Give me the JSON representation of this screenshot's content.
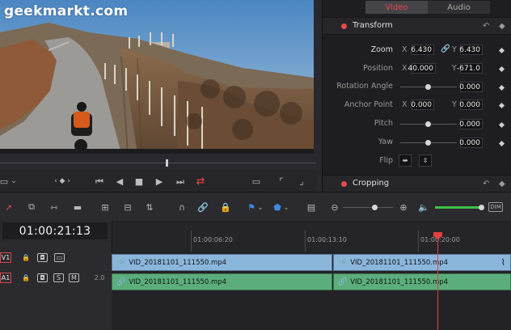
{
  "watermark": "geekmarkt.com",
  "inspector": {
    "tabs": [
      {
        "label": "Video",
        "active": true
      },
      {
        "label": "Audio",
        "active": false
      }
    ],
    "transform": {
      "title": "Transform",
      "zoom": {
        "label": "Zoom",
        "x": "6.430",
        "y": "6.430"
      },
      "position": {
        "label": "Position",
        "x": "40.000",
        "y": "-671.0"
      },
      "rotation_angle": {
        "label": "Rotation Angle",
        "value": "0.000"
      },
      "anchor_point": {
        "label": "Anchor Point",
        "x": "0.000",
        "y": "0.000"
      },
      "pitch": {
        "label": "Pitch",
        "value": "0.000"
      },
      "yaw": {
        "label": "Yaw",
        "value": "0.000"
      },
      "flip": {
        "label": "Flip"
      },
      "axis_x": "X",
      "axis_y": "Y"
    },
    "cropping": {
      "title": "Cropping"
    }
  },
  "toolbar": {
    "dim_label": "DIM"
  },
  "timeline": {
    "timecode": "01:00:21:13",
    "ruler_labels": [
      "01:00:06:20",
      "01:00:13:10",
      "01:00:20:00"
    ],
    "tracks": [
      {
        "id": "V1",
        "type": "video"
      },
      {
        "id": "A1",
        "type": "audio",
        "solo": "S",
        "mute": "M",
        "level": "2.0"
      }
    ],
    "video_clips": [
      {
        "name": "VID_20181101_111550.mp4"
      },
      {
        "name": "VID_20181101_111550.mp4"
      }
    ],
    "audio_clips": [
      {
        "name": "VID_20181101_111550.mp4"
      },
      {
        "name": "VID_20181101_111550.mp4"
      }
    ]
  },
  "colors": {
    "accent_red": "#e04040",
    "video_clip": "#8bb6dc",
    "audio_clip": "#5bae7b",
    "volume_green": "#3fc24a"
  }
}
